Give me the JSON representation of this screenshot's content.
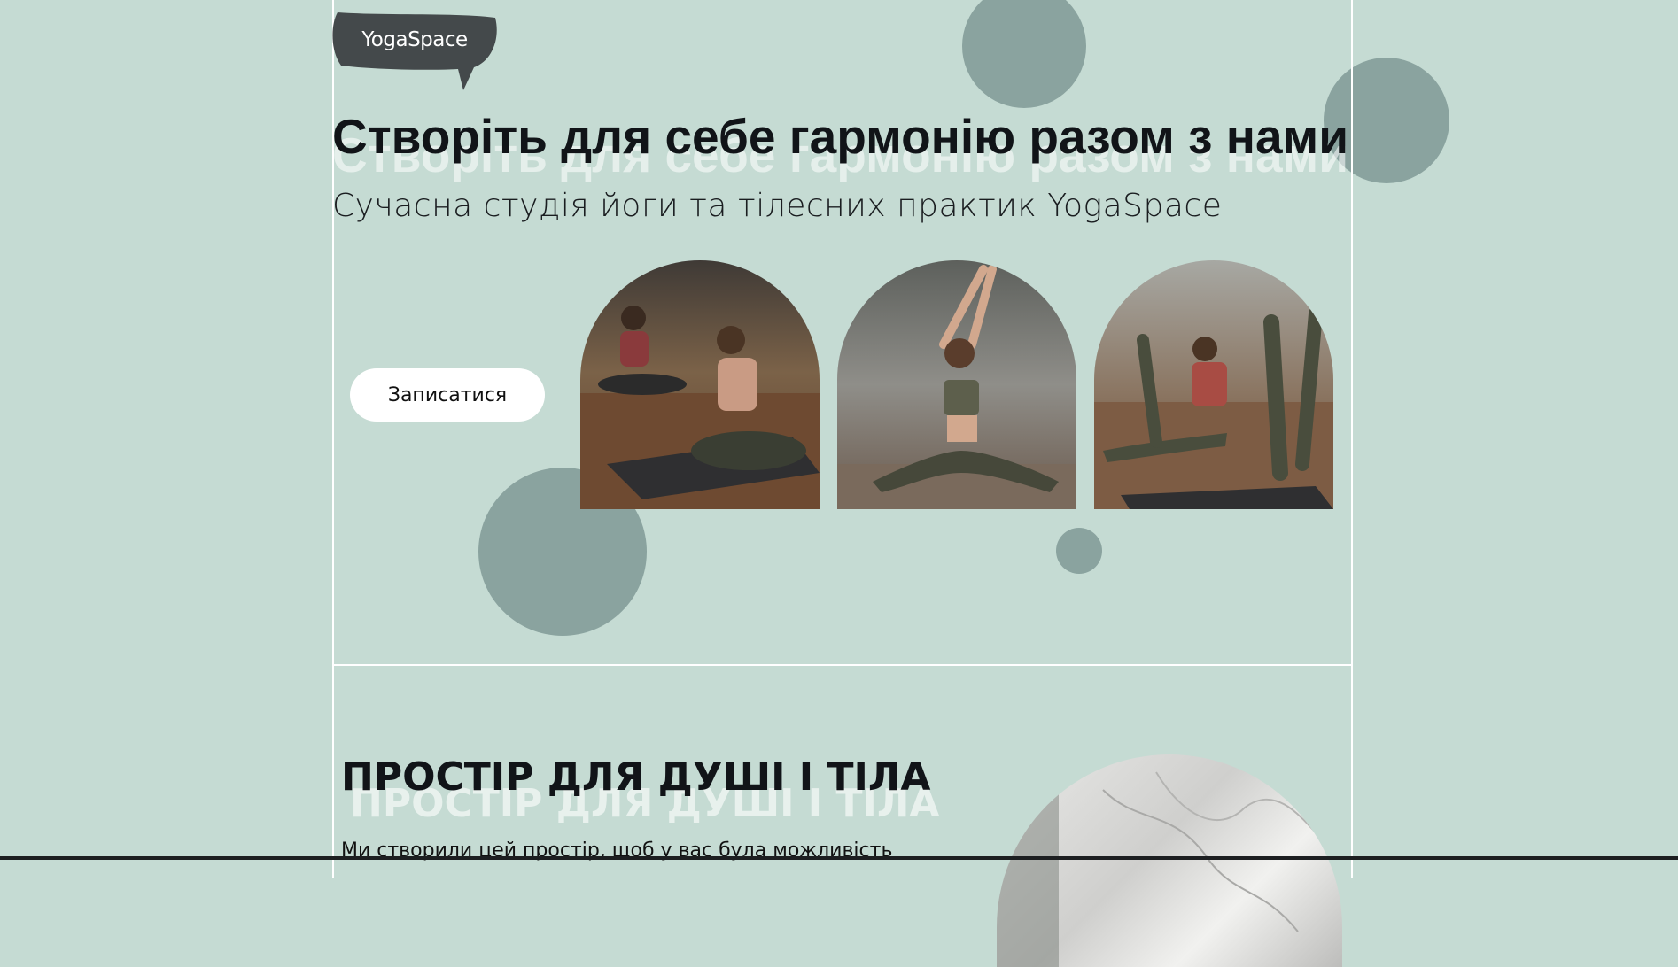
{
  "logo": {
    "text": "YogaSpace",
    "color": "#44494b"
  },
  "hero": {
    "title": "Створіть для себе гармонію разом з нами",
    "subtitle": "Сучасна студія йоги та тілесних практик YogaSpace",
    "cta_label": "Записатися",
    "images": [
      {
        "name": "two-women-yoga-mats-photo"
      },
      {
        "name": "woman-arms-raised-stretch-photo"
      },
      {
        "name": "women-leg-stretch-photo"
      }
    ]
  },
  "section2": {
    "title": "ПРОСТІР ДЛЯ ДУШІ І ТІЛА",
    "text": "Ми створили цей простір, щоб у вас була можливість",
    "image": {
      "name": "marble-interior-photo"
    }
  },
  "colors": {
    "background": "#c5dbd3",
    "circle": "#8aa39f",
    "title": "#111418",
    "button_bg": "#ffffff"
  }
}
